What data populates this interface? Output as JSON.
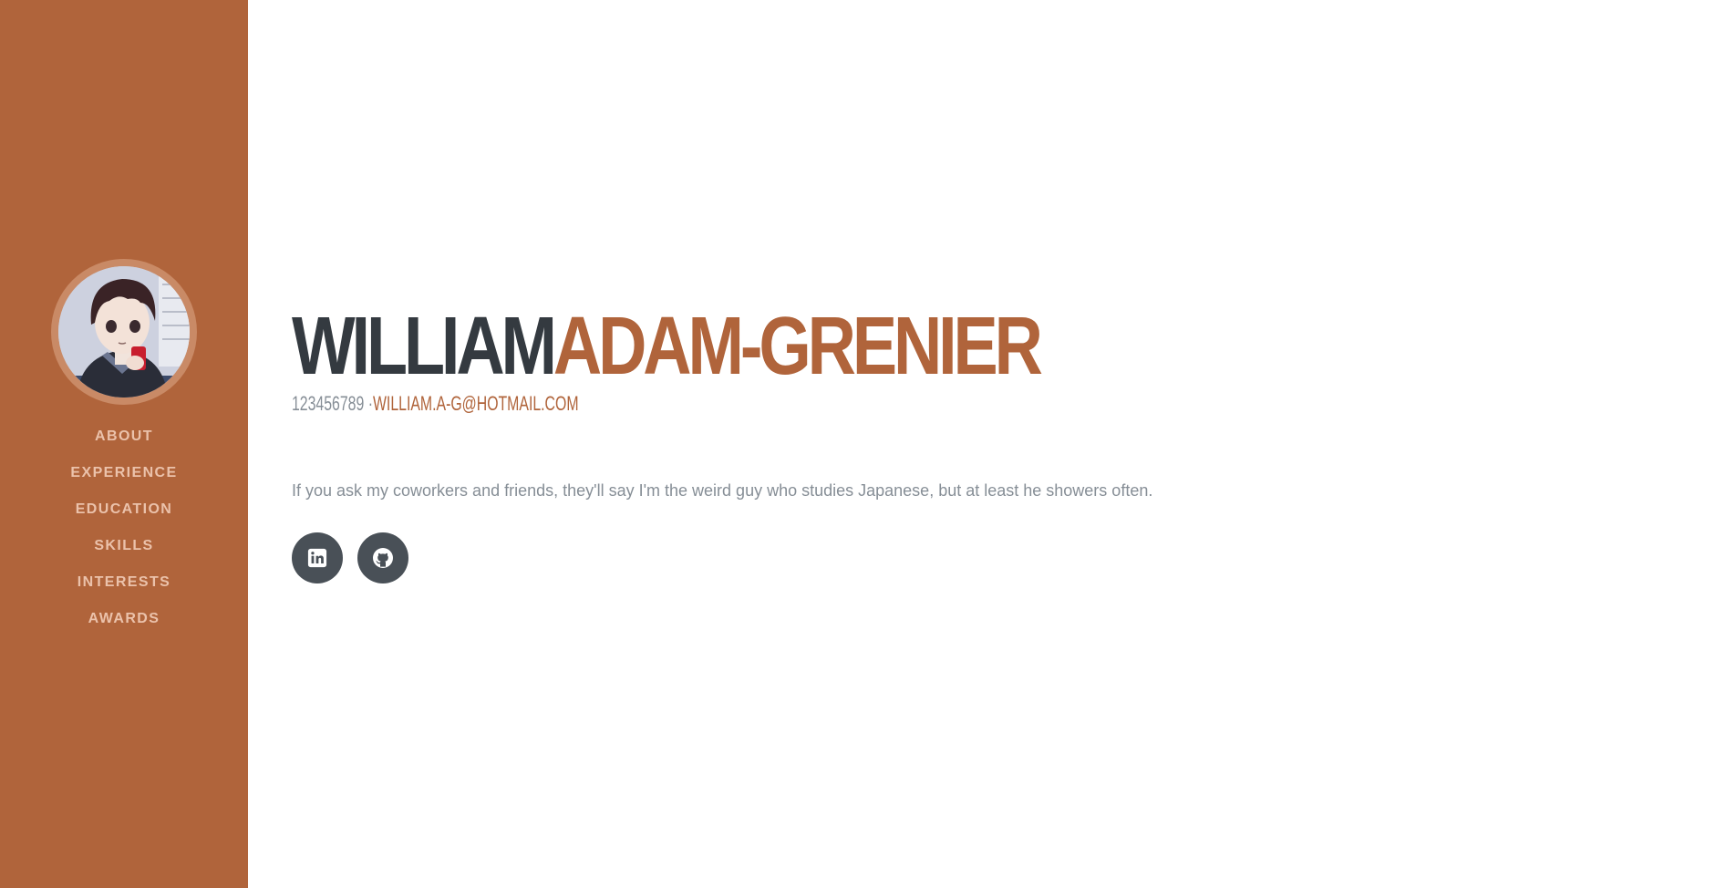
{
  "sidebar": {
    "avatar_alt": "profile picture",
    "nav": [
      {
        "label": "ABOUT"
      },
      {
        "label": "EXPERIENCE"
      },
      {
        "label": "EDUCATION"
      },
      {
        "label": "SKILLS"
      },
      {
        "label": "INTERESTS"
      },
      {
        "label": "AWARDS"
      }
    ]
  },
  "about": {
    "first_name": "WILLIAM",
    "last_name": "ADAM-GRENIER",
    "phone": "123456789",
    "separator": " ·",
    "email": "WILLIAM.A-G@HOTMAIL.COM",
    "lead": "If you ask my coworkers and friends, they'll say I'm the weird guy who studies Japanese, but at least he showers often."
  },
  "social": [
    {
      "icon": "linkedin-icon"
    },
    {
      "icon": "github-icon"
    }
  ],
  "colors": {
    "primary": "#b0643b",
    "dark": "#343a40",
    "muted": "#868e96",
    "social_bg": "#495057"
  }
}
